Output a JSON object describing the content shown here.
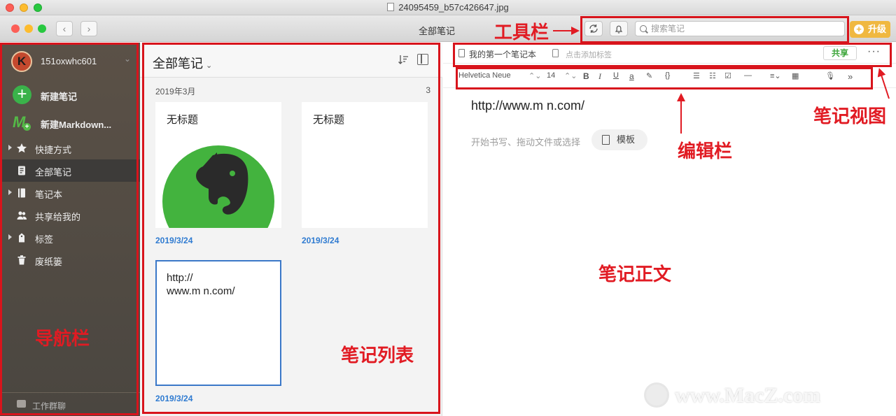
{
  "window": {
    "file_title": "24095459_b57c426647.jpg",
    "center_title": "全部笔记"
  },
  "toolbar": {
    "back_glyph": "‹",
    "forward_glyph": "›",
    "search_placeholder": "搜索笔记",
    "upgrade_label": "升级",
    "upgrade_glyph": "+"
  },
  "sidebar": {
    "avatar_letter": "K",
    "username": "151oxwhc601",
    "user_chevron": "⌄",
    "new_note_glyph": "+",
    "new_note": "新建笔记",
    "new_md_glyph": "M",
    "new_markdown": "新建Markdown...",
    "items": [
      {
        "label": "快捷方式",
        "icon": "star-icon"
      },
      {
        "label": "全部笔记",
        "icon": "note-icon"
      },
      {
        "label": "笔记本",
        "icon": "notebook-icon"
      },
      {
        "label": "共享给我的",
        "icon": "people-icon"
      },
      {
        "label": "标签",
        "icon": "tag-icon"
      },
      {
        "label": "废纸篓",
        "icon": "trash-icon"
      }
    ],
    "work_chat": "工作群聊"
  },
  "notelist": {
    "title": "全部笔记",
    "title_chevron": "⌄",
    "month": "2019年3月",
    "count": "3",
    "notes": [
      {
        "title": "无标题",
        "date": "2019/3/24"
      },
      {
        "title": "无标题",
        "date": "2019/3/24"
      },
      {
        "text": "http://\nwww.m       n.com/",
        "date": "2019/3/24"
      }
    ]
  },
  "editor": {
    "notebook_name": "我的第一个笔记本",
    "tag_placeholder": "点击添加标签",
    "share_label": "共享",
    "more_label": "···",
    "font": "Helvetica Neue",
    "font_size": "14",
    "updown_glyph": "⌃⌄",
    "bold_glyph": "B",
    "italic_glyph": "I",
    "underline_glyph": "U",
    "color_glyph": "a",
    "highlight_glyph": "✎",
    "code_glyph": "{}",
    "bullet_glyph": "☰",
    "number_glyph": "☷",
    "check_glyph": "☑",
    "hr_glyph": "—",
    "align_glyph": "≡⌄",
    "table_glyph": "▦",
    "mic_glyph": "🎙",
    "expand_glyph": "»",
    "body_url": "http://www.m       n.com/",
    "body_placeholder": "开始书写、拖动文件或选择",
    "template_label": "模板"
  },
  "annotations": {
    "toolbar": "工具栏",
    "note_view": "笔记视图",
    "edit_bar": "编辑栏",
    "note_body": "笔记正文",
    "nav_bar": "导航栏",
    "note_list": "笔记列表",
    "color": "#d8141c"
  },
  "watermark": "www.MacZ.com"
}
